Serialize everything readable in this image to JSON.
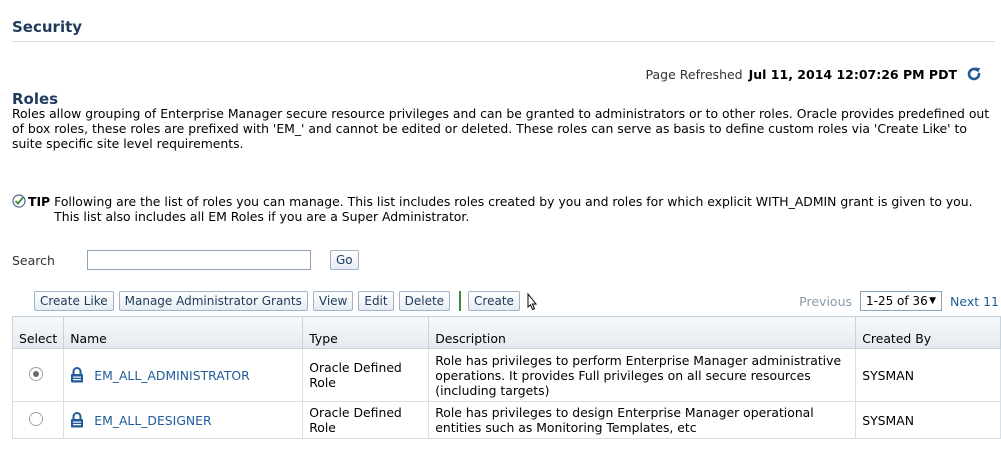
{
  "header": {
    "title": "Security"
  },
  "refresh": {
    "label": "Page Refreshed",
    "value": "Jul 11, 2014 12:07:26 PM PDT"
  },
  "roles": {
    "title": "Roles",
    "description": "Roles allow grouping of Enterprise Manager secure resource privileges and can be granted to administrators or to other roles. Oracle provides predefined out of box roles, these roles are prefixed with 'EM_' and cannot be edited or deleted. These roles can serve as basis to define custom roles via 'Create Like' to suite specific site level requirements."
  },
  "tip": {
    "label": "TIP",
    "text": "Following are the list of roles you can manage. This list includes roles created by you and roles for which explicit WITH_ADMIN grant is given to you. This list also includes all EM Roles if you are a Super Administrator."
  },
  "search": {
    "label": "Search",
    "value": "",
    "go_label": "Go"
  },
  "toolbar": {
    "create_like": "Create Like",
    "manage_grants": "Manage Administrator Grants",
    "view": "View",
    "edit": "Edit",
    "delete": "Delete",
    "create": "Create"
  },
  "pager": {
    "previous": "Previous",
    "range": "1-25 of 36",
    "next": "Next 11"
  },
  "table": {
    "headers": {
      "select": "Select",
      "name": "Name",
      "type": "Type",
      "description": "Description",
      "created_by": "Created By"
    },
    "rows": [
      {
        "selected": true,
        "name": "EM_ALL_ADMINISTRATOR",
        "type": "Oracle Defined Role",
        "description": "Role has privileges to perform Enterprise Manager administrative operations. It provides Full privileges on all secure resources (including targets)",
        "created_by": "SYSMAN"
      },
      {
        "selected": false,
        "name": "EM_ALL_DESIGNER",
        "type": "Oracle Defined Role",
        "description": "Role has privileges to design Enterprise Manager operational entities such as Monitoring Templates, etc",
        "created_by": "SYSMAN"
      }
    ]
  },
  "icons": {
    "refresh": "refresh-icon",
    "tip": "check-icon",
    "lock": "lock-icon",
    "cursor": "mouse-pointer-icon"
  },
  "colors": {
    "heading": "#1f3a5c",
    "link": "#1f5c99",
    "accent_green": "#3b8a3b"
  }
}
